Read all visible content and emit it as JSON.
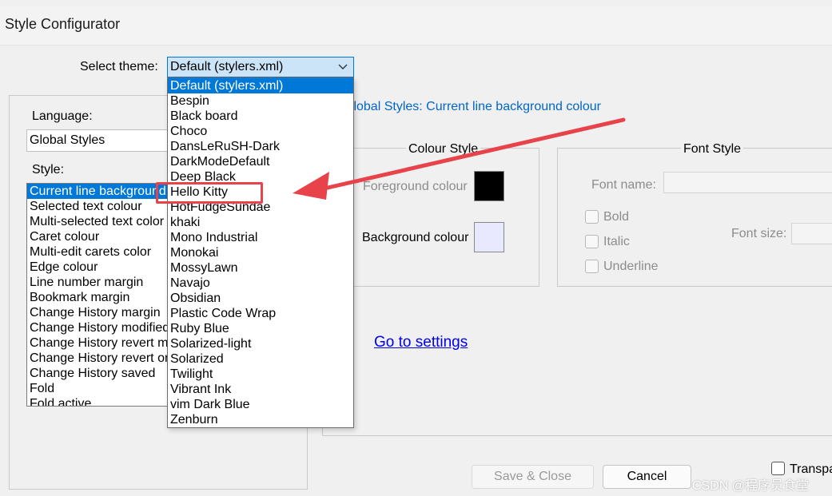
{
  "window": {
    "title": "Style Configurator"
  },
  "theme_select": {
    "label": "Select theme:",
    "value": "Default (stylers.xml)",
    "options": [
      "Default (stylers.xml)",
      "Bespin",
      "Black board",
      "Choco",
      "DansLeRuSH-Dark",
      "DarkModeDefault",
      "Deep Black",
      "Hello Kitty",
      "HotFudgeSundae",
      "khaki",
      "Mono Industrial",
      "Monokai",
      "MossyLawn",
      "Navajo",
      "Obsidian",
      "Plastic Code Wrap",
      "Ruby Blue",
      "Solarized-light",
      "Solarized",
      "Twilight",
      "Vibrant Ink",
      "vim Dark Blue",
      "Zenburn"
    ],
    "highlighted_option": "Default (stylers.xml)",
    "annotated_option": "Hello Kitty"
  },
  "language": {
    "label": "Language:",
    "value": "Global Styles"
  },
  "style": {
    "label": "Style:",
    "items": [
      "Current line background colour",
      "Selected text colour",
      "Multi-selected text color",
      "Caret colour",
      "Multi-edit carets color",
      "Edge colour",
      "Line number margin",
      "Bookmark margin",
      "Change History margin",
      "Change History modified",
      "Change History revert modified",
      "Change History revert origin",
      "Change History saved",
      "Fold",
      "Fold active"
    ],
    "selected_index": 0
  },
  "header_text": "Global Styles: Current line background colour",
  "colour_style": {
    "title": "Colour Style",
    "foreground_label": "Foreground colour",
    "foreground_color": "#000000",
    "background_label": "Background colour",
    "background_color": "#e8e8ff"
  },
  "font_style": {
    "title": "Font Style",
    "font_name_label": "Font name:",
    "bold_label": "Bold",
    "italic_label": "Italic",
    "underline_label": "Underline",
    "font_size_label": "Font size:"
  },
  "go_to_settings": "Go to settings",
  "buttons": {
    "save_close": "Save & Close",
    "cancel": "Cancel"
  },
  "transparency_label": "Transpa",
  "watermark": "CSDN @程序员食堂",
  "annotation_color": "#e8434b"
}
